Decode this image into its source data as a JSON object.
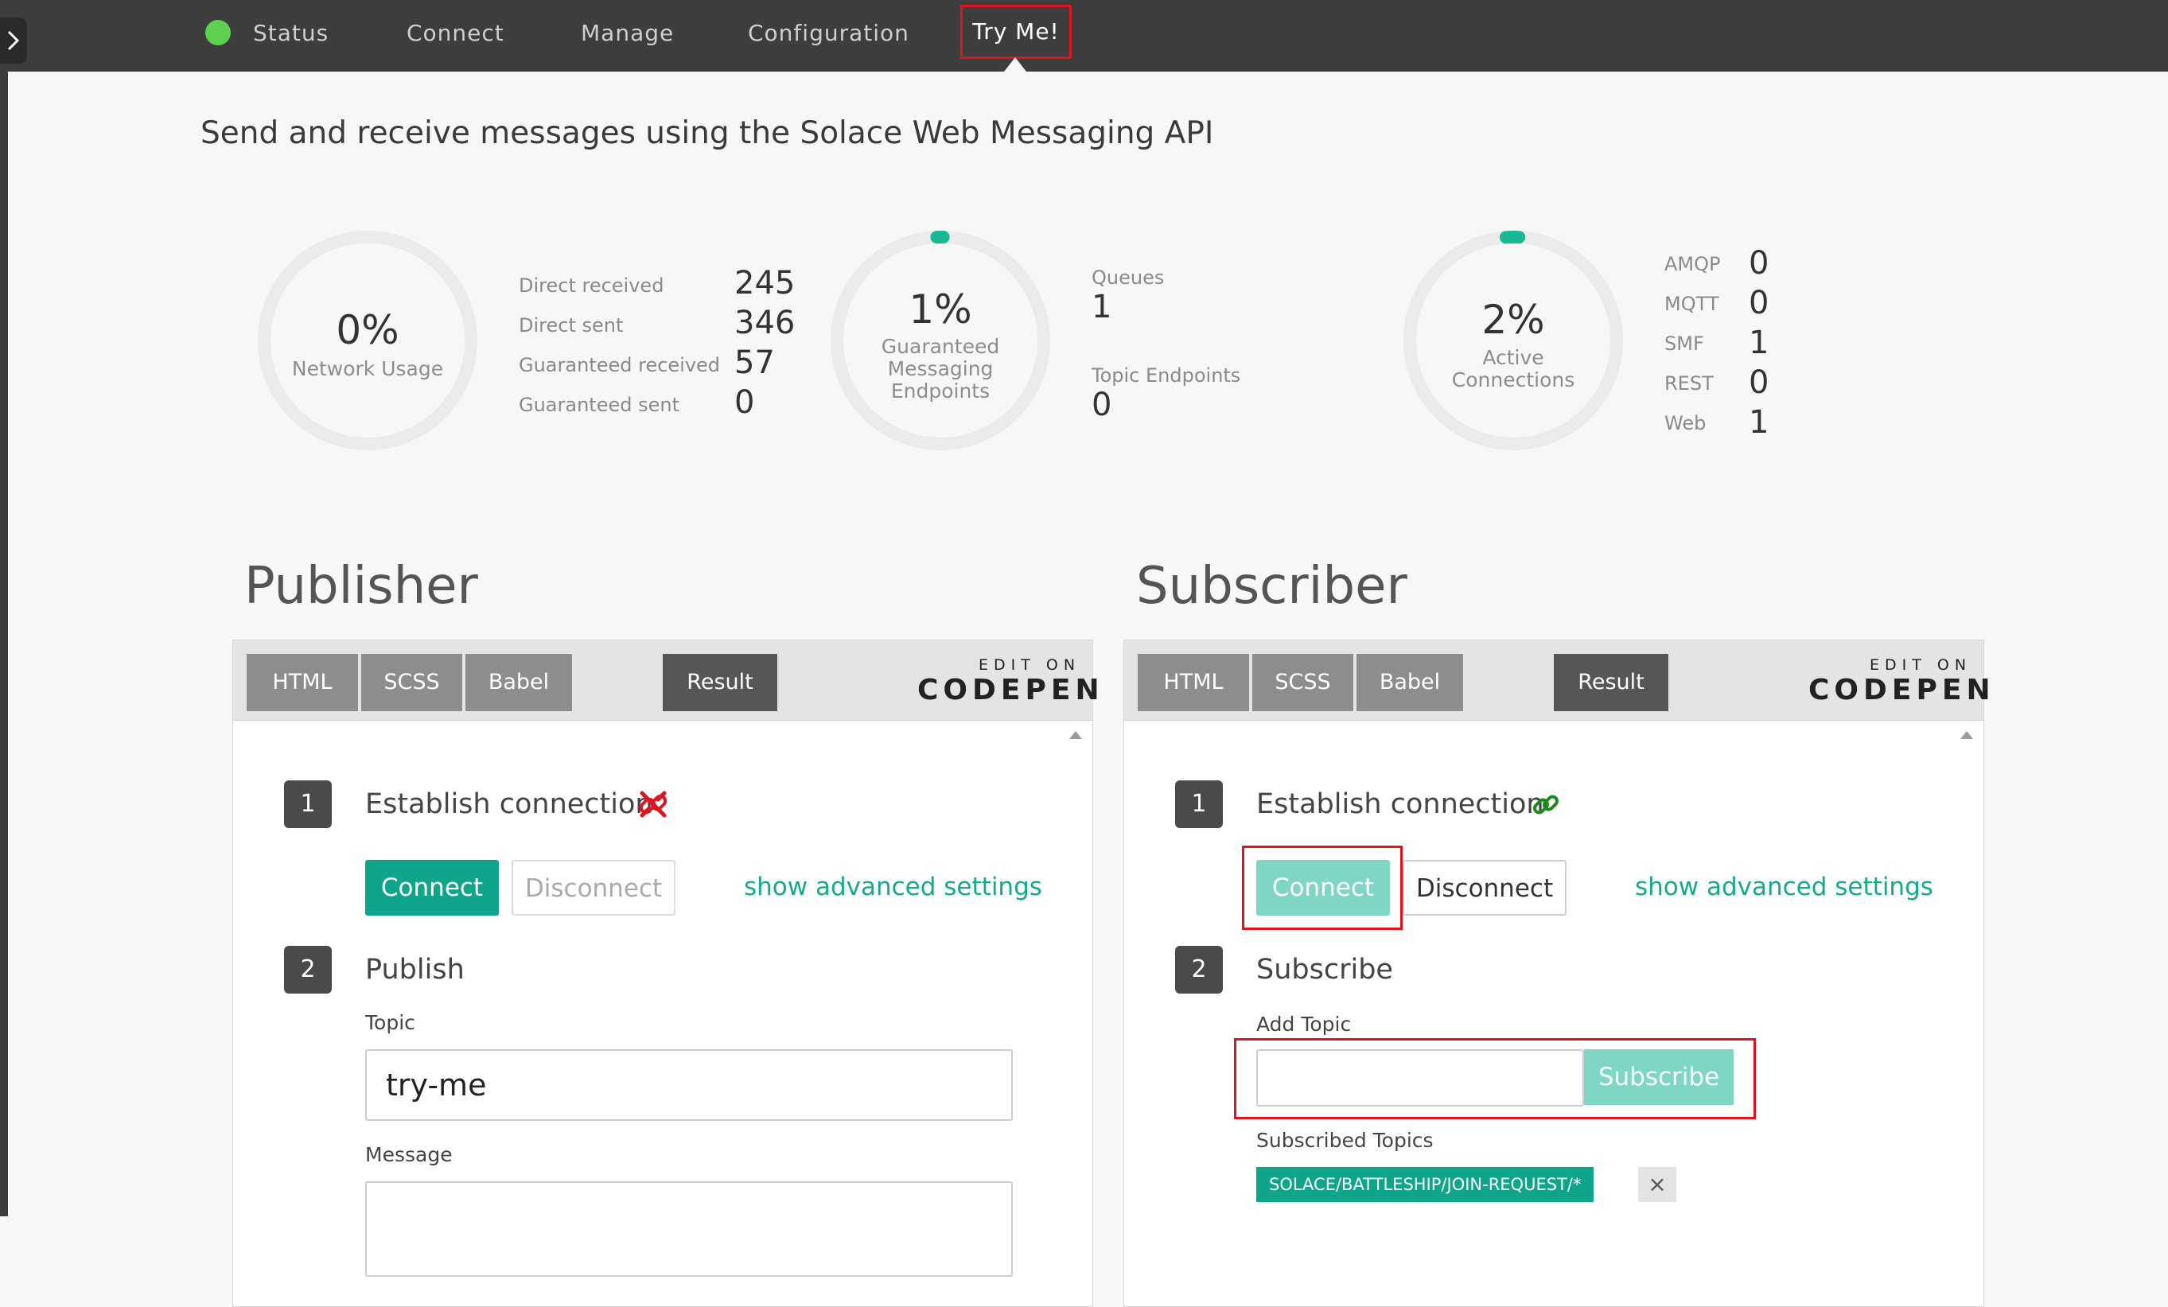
{
  "nav": {
    "items": [
      {
        "label": "Status"
      },
      {
        "label": "Connect"
      },
      {
        "label": "Manage"
      },
      {
        "label": "Configuration"
      },
      {
        "label": "Try Me!"
      }
    ],
    "status_color": "#5ed04f"
  },
  "headline": "Send and receive messages using the Solace Web Messaging API",
  "gauges": {
    "network": {
      "pct": "0%",
      "label": "Network Usage",
      "value": 0
    },
    "guaranteed": {
      "pct": "1%",
      "label_lines": [
        "Guaranteed",
        "Messaging",
        "Endpoints"
      ],
      "value": 1
    },
    "connections": {
      "pct": "2%",
      "label_lines": [
        "Active",
        "Connections"
      ],
      "value": 2
    }
  },
  "message_stats": [
    {
      "label": "Direct received",
      "value": "245"
    },
    {
      "label": "Direct sent",
      "value": "346"
    },
    {
      "label": "Guaranteed received",
      "value": "57"
    },
    {
      "label": "Guaranteed sent",
      "value": "0"
    }
  ],
  "endpoint_stats": [
    {
      "label": "Queues",
      "value": "1"
    },
    {
      "label": "Topic Endpoints",
      "value": "0"
    }
  ],
  "protocol_stats": [
    {
      "label": "AMQP",
      "value": "0"
    },
    {
      "label": "MQTT",
      "value": "0"
    },
    {
      "label": "SMF",
      "value": "1"
    },
    {
      "label": "REST",
      "value": "0"
    },
    {
      "label": "Web",
      "value": "1"
    }
  ],
  "publisher": {
    "title": "Publisher",
    "tabs": [
      "HTML",
      "SCSS",
      "Babel"
    ],
    "result_label": "Result",
    "codepen_edit": "EDIT ON",
    "codepen_logo": "CODEPEN",
    "step1": {
      "num": "1",
      "title": "Establish connection",
      "status_icon": "broken-link-icon"
    },
    "connect_label": "Connect",
    "disconnect_label": "Disconnect",
    "advanced_link": "show advanced settings",
    "step2": {
      "num": "2",
      "title": "Publish"
    },
    "topic_label": "Topic",
    "topic_value": "try-me",
    "message_label": "Message"
  },
  "subscriber": {
    "title": "Subscriber",
    "tabs": [
      "HTML",
      "SCSS",
      "Babel"
    ],
    "result_label": "Result",
    "codepen_edit": "EDIT ON",
    "codepen_logo": "CODEPEN",
    "step1": {
      "num": "1",
      "title": "Establish connection",
      "status_icon": "link-icon"
    },
    "connect_label": "Connect",
    "disconnect_label": "Disconnect",
    "advanced_link": "show advanced settings",
    "step2": {
      "num": "2",
      "title": "Subscribe"
    },
    "add_topic_label": "Add Topic",
    "add_topic_value": "",
    "subscribe_label": "Subscribe",
    "subscribed_topics_label": "Subscribed Topics",
    "subscribed_topics": [
      "SOLACE/BATTLESHIP/JOIN-REQUEST/*"
    ]
  },
  "colors": {
    "accent": "#0fa58a",
    "accent_disabled": "#7fd6c5",
    "highlight": "#e0141e",
    "nav_bg": "#3d3d3d"
  }
}
